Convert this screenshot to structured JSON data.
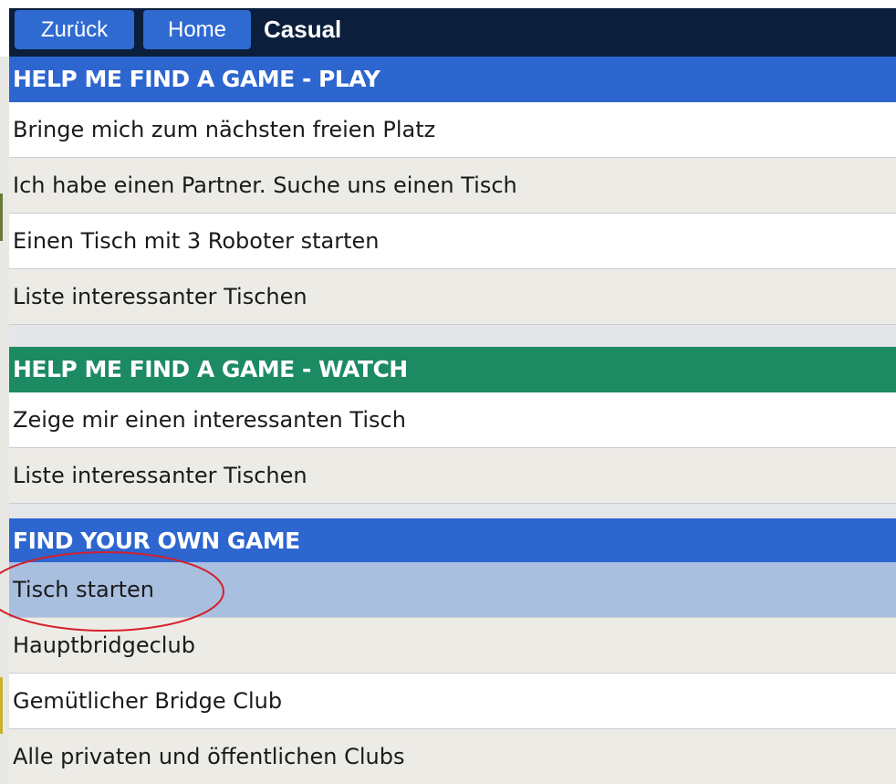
{
  "topbar": {
    "back_label": "Zurück",
    "home_label": "Home",
    "title": "Casual"
  },
  "sections": {
    "play": {
      "header": "HELP ME FIND A GAME - PLAY",
      "items": [
        "Bringe mich zum nächsten freien Platz",
        "Ich habe einen Partner. Suche uns einen Tisch",
        "Einen Tisch mit 3 Roboter starten",
        "Liste interessanter Tischen"
      ]
    },
    "watch": {
      "header": "HELP ME FIND A GAME - WATCH",
      "items": [
        "Zeige mir einen interessanten Tisch",
        "Liste interessanter Tischen"
      ]
    },
    "own": {
      "header": "FIND YOUR OWN GAME",
      "items": [
        "Tisch starten",
        "Hauptbridgeclub",
        "Gemütlicher Bridge Club",
        "Alle privaten und öffentlichen Clubs"
      ],
      "selected_index": 0
    }
  },
  "colors": {
    "topbar": "#0b1e3b",
    "button": "#2f6ad1",
    "header_blue": "#2e66cf",
    "header_green": "#1c8a62",
    "row_grey": "#ecebe6",
    "row_selected": "#a9bfe0",
    "annotation_circle": "#d4202a"
  }
}
